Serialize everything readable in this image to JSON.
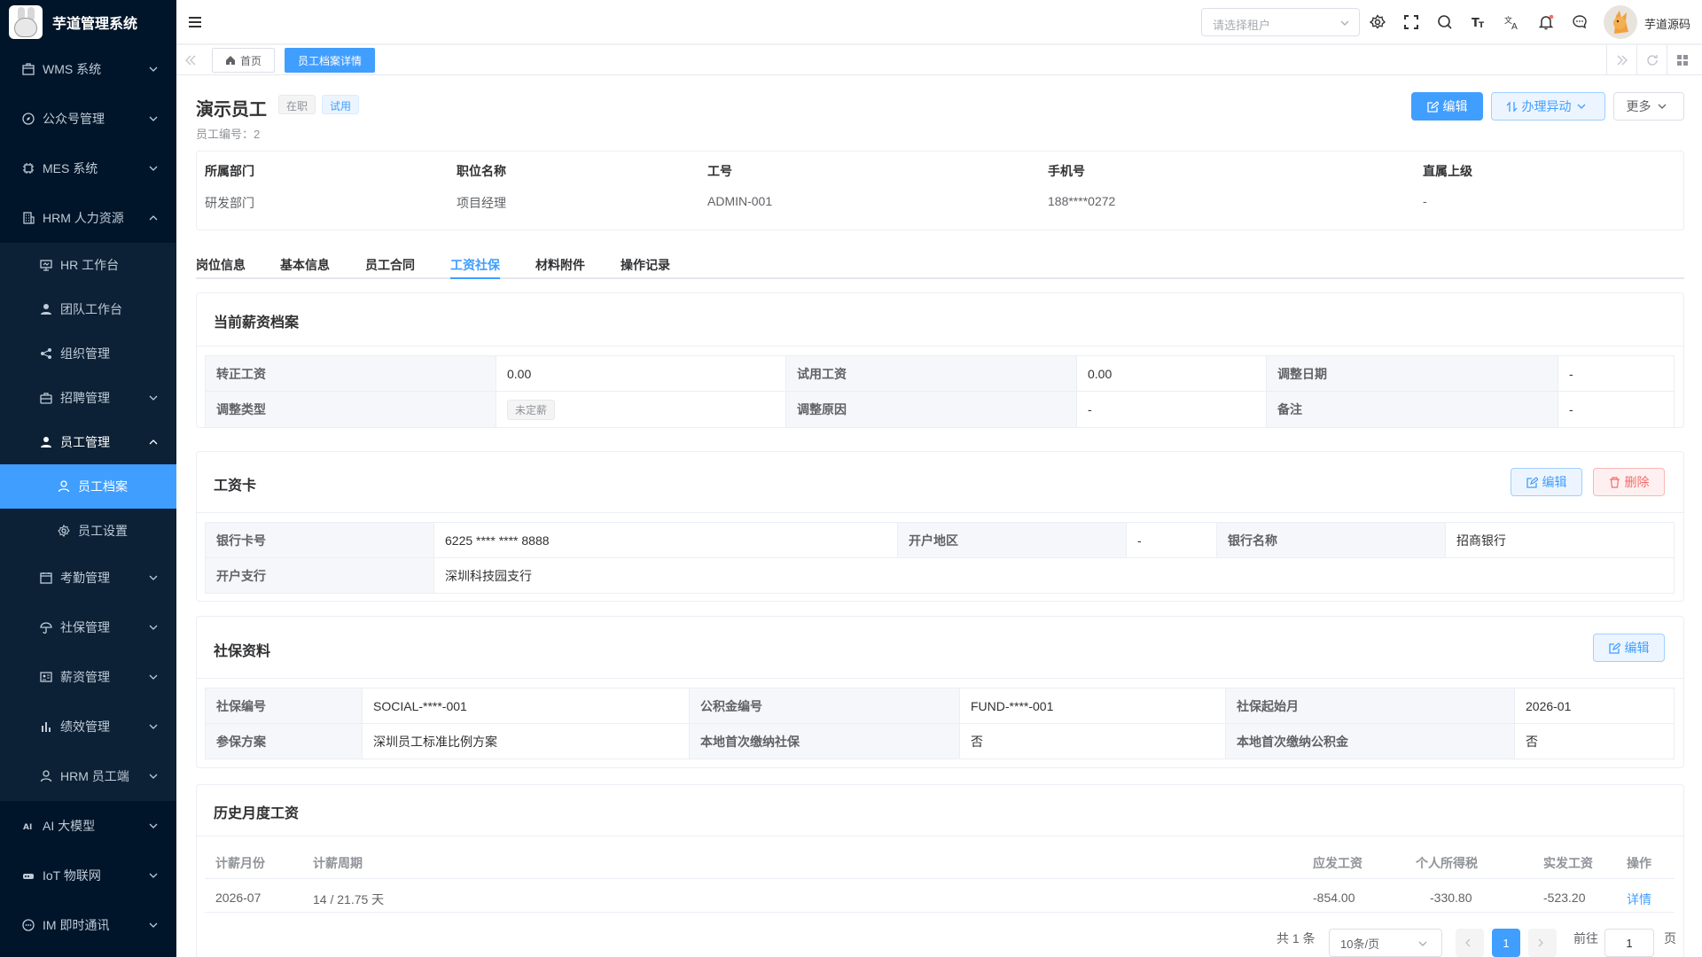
{
  "app": {
    "title": "芋道管理系统"
  },
  "sidebar": {
    "items": [
      {
        "label": "WMS 系统",
        "icon": "box-icon"
      },
      {
        "label": "公众号管理",
        "icon": "compass-icon"
      },
      {
        "label": "MES 系统",
        "icon": "cpu-icon"
      },
      {
        "label": "HRM 人力资源",
        "icon": "building-icon"
      },
      {
        "label": "HR 工作台",
        "icon": "workbench-icon"
      },
      {
        "label": "团队工作台",
        "icon": "user-icon"
      },
      {
        "label": "组织管理",
        "icon": "share-icon"
      },
      {
        "label": "招聘管理",
        "icon": "briefcase-icon"
      },
      {
        "label": "员工管理",
        "icon": "user-icon"
      },
      {
        "label": "员工档案",
        "icon": "user-outline-icon"
      },
      {
        "label": "员工设置",
        "icon": "gear-icon"
      },
      {
        "label": "考勤管理",
        "icon": "calendar-icon"
      },
      {
        "label": "社保管理",
        "icon": "umbrella-icon"
      },
      {
        "label": "薪资管理",
        "icon": "wallet-icon"
      },
      {
        "label": "绩效管理",
        "icon": "bar-chart-icon"
      },
      {
        "label": "HRM 员工端",
        "icon": "user-outline-icon"
      },
      {
        "label": "AI 大模型",
        "icon": "ai-icon"
      },
      {
        "label": "IoT 物联网",
        "icon": "iot-icon"
      },
      {
        "label": "IM 即时通讯",
        "icon": "chat-icon"
      }
    ]
  },
  "header": {
    "tenant_placeholder": "请选择租户",
    "user_name": "芋道源码"
  },
  "tags": {
    "home": "首页",
    "current": "员工档案详情"
  },
  "employee": {
    "name": "演示员工",
    "status_tag": "在职",
    "probation_tag": "试用",
    "no_label": "员工编号：2"
  },
  "actions": {
    "edit": "编辑",
    "change": "办理异动",
    "more": "更多"
  },
  "summary": {
    "dept_label": "所属部门",
    "dept": "研发部门",
    "position_label": "职位名称",
    "position": "项目经理",
    "job_no_label": "工号",
    "job_no": "ADMIN-001",
    "phone_label": "手机号",
    "phone": "188****0272",
    "leader_label": "直属上级",
    "leader": "-"
  },
  "tabs": [
    "岗位信息",
    "基本信息",
    "员工合同",
    "工资社保",
    "材料附件",
    "操作记录"
  ],
  "salary": {
    "title": "当前薪资档案",
    "regular_label": "转正工资",
    "regular": "0.00",
    "probation_label": "试用工资",
    "probation": "0.00",
    "adjust_date_label": "调整日期",
    "adjust_date": "-",
    "adjust_type_label": "调整类型",
    "adjust_type": "未定薪",
    "adjust_reason_label": "调整原因",
    "adjust_reason": "-",
    "remark_label": "备注",
    "remark": "-"
  },
  "bankcard": {
    "title": "工资卡",
    "edit": "编辑",
    "delete": "删除",
    "card_no_label": "银行卡号",
    "card_no": "6225 **** **** 8888",
    "region_label": "开户地区",
    "region": "-",
    "bank_label": "银行名称",
    "bank": "招商银行",
    "branch_label": "开户支行",
    "branch": "深圳科技园支行"
  },
  "social": {
    "title": "社保资料",
    "edit": "编辑",
    "social_no_label": "社保编号",
    "social_no": "SOCIAL-****-001",
    "fund_no_label": "公积金编号",
    "fund_no": "FUND-****-001",
    "start_label": "社保起始月",
    "start": "2026-01",
    "plan_label": "参保方案",
    "plan": "深圳员工标准比例方案",
    "first_social_label": "本地首次缴纳社保",
    "first_social": "否",
    "first_fund_label": "本地首次缴纳公积金",
    "first_fund": "否"
  },
  "history": {
    "title": "历史月度工资",
    "columns": {
      "month": "计薪月份",
      "period": "计薪周期",
      "gross": "应发工资",
      "tax": "个人所得税",
      "net": "实发工资",
      "op": "操作"
    },
    "rows": [
      {
        "month": "2026-07",
        "period": "14 / 21.75 天",
        "gross": "-854.00",
        "tax": "-330.80",
        "net": "-523.20",
        "op": "详情"
      }
    ]
  },
  "pagination": {
    "total": "共 1 条",
    "page_size": "10条/页",
    "current": "1",
    "goto_label": "前往",
    "goto_value": "1",
    "page_suffix": "页"
  },
  "colors": {
    "primary": "#409eff",
    "sidebar_bg": "#001529",
    "danger": "#f56c6c"
  }
}
